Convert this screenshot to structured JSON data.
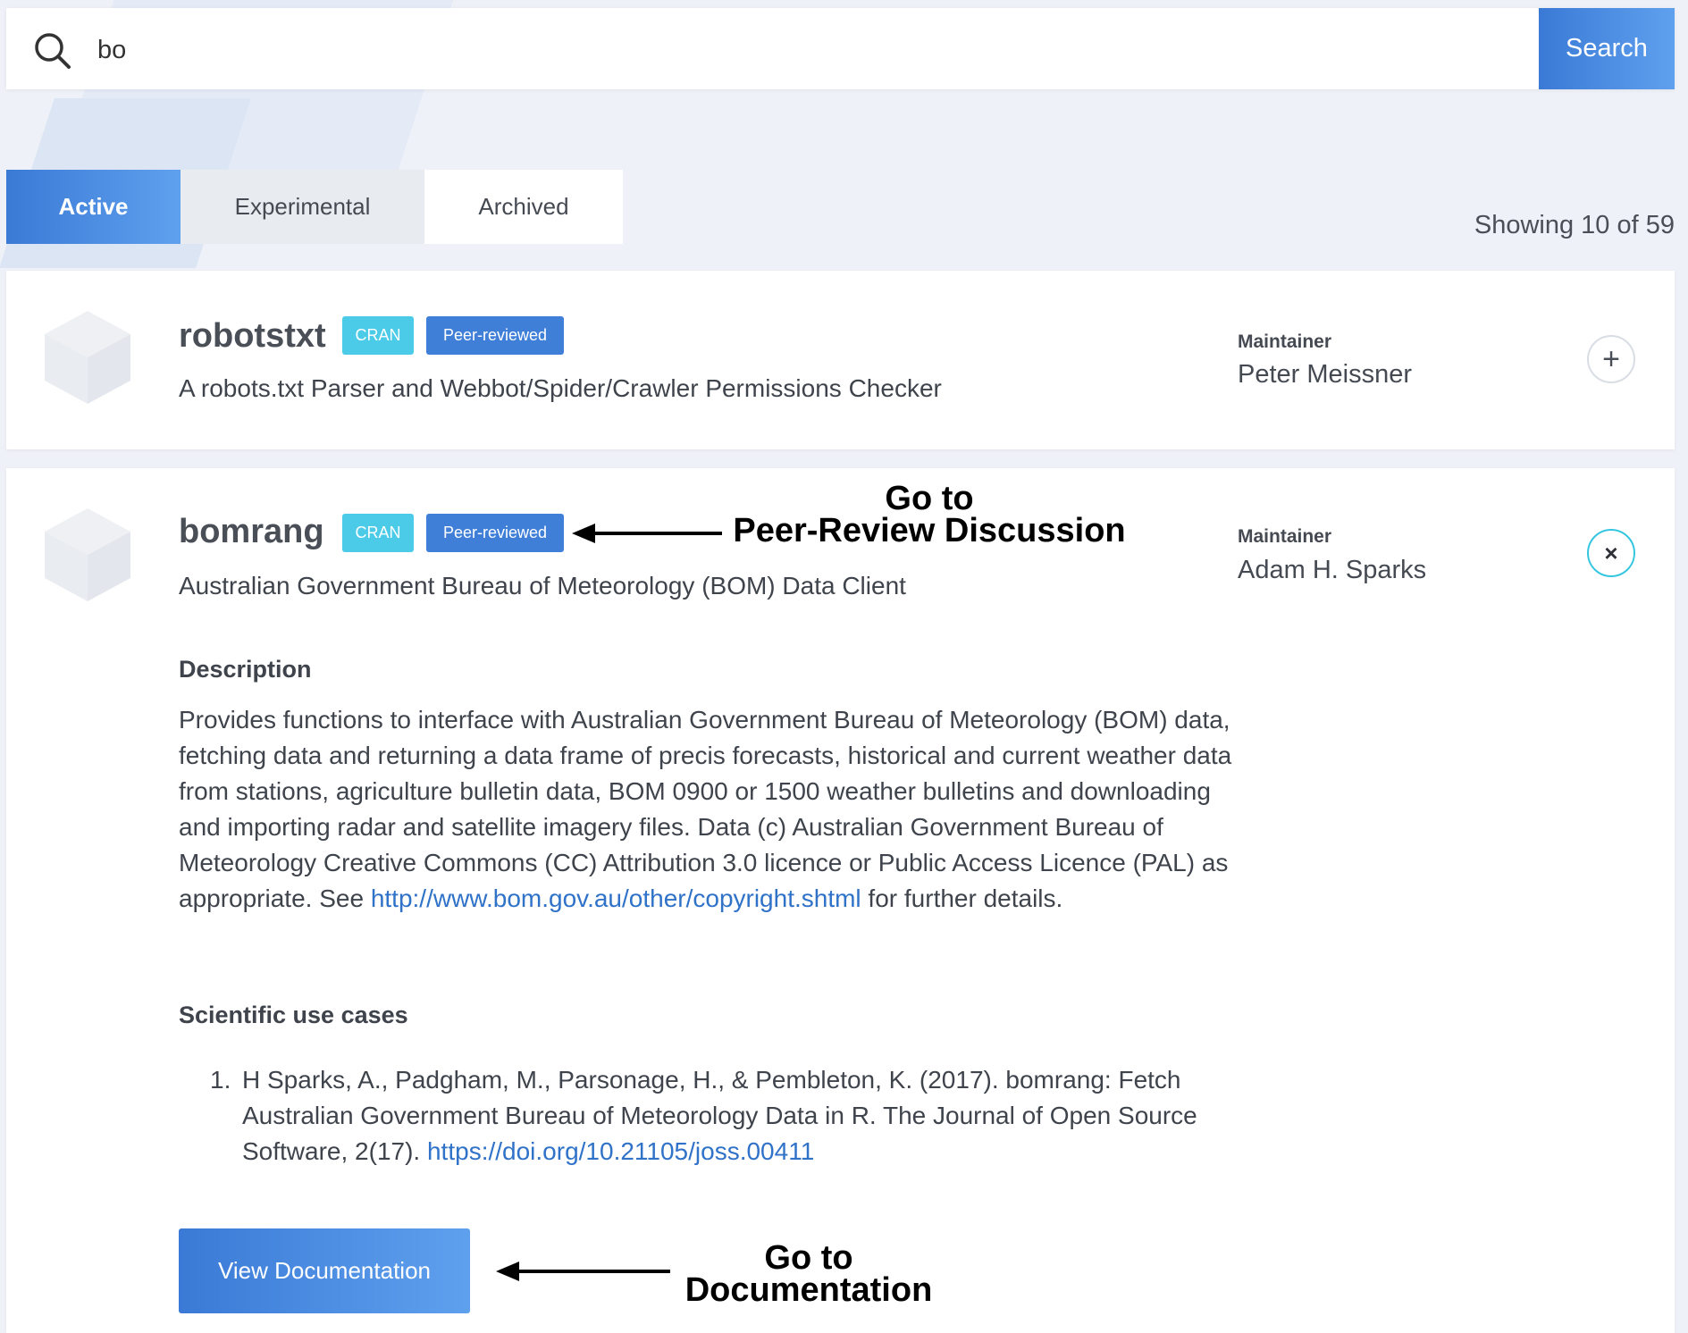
{
  "search": {
    "value": "bo",
    "button_label": "Search"
  },
  "tabs": [
    {
      "label": "Active",
      "active": true
    },
    {
      "label": "Experimental",
      "active": false
    },
    {
      "label": "Archived",
      "active": false
    }
  ],
  "results_count": "Showing 10 of 59",
  "packages": [
    {
      "name": "robotstxt",
      "badges": [
        "CRAN",
        "Peer-reviewed"
      ],
      "title": "A robots.txt Parser and Webbot/Spider/Crawler Permissions Checker",
      "maintainer_label": "Maintainer",
      "maintainer": "Peter Meissner",
      "toggle": "+"
    },
    {
      "name": "bomrang",
      "badges": [
        "CRAN",
        "Peer-reviewed"
      ],
      "title": "Australian Government Bureau of Meteorology (BOM) Data Client",
      "maintainer_label": "Maintainer",
      "maintainer": "Adam H. Sparks",
      "toggle": "×",
      "description_heading": "Description",
      "description_text": "Provides functions to interface with Australian Government Bureau of Meteorology (BOM) data, fetching data and returning a data frame of precis forecasts, historical and current weather data from stations, agriculture bulletin data, BOM 0900 or 1500 weather bulletins and downloading and importing radar and satellite imagery files. Data (c) Australian Government Bureau of Meteorology Creative Commons (CC) Attribution 3.0 licence or Public Access Licence (PAL) as appropriate. See ",
      "description_link": "http://www.bom.gov.au/other/copyright.shtml",
      "description_suffix": " for further details.",
      "use_cases_heading": "Scientific use cases",
      "use_cases": [
        {
          "number": "1.",
          "text": "H Sparks, A., Padgham, M., Parsonage, H., & Pembleton, K. (2017). bomrang: Fetch Australian Government Bureau of Meteorology Data in R. The Journal of Open Source Software, 2(17). ",
          "link": "https://doi.org/10.21105/joss.00411"
        }
      ],
      "doc_button_label": "View Documentation"
    }
  ],
  "annotations": {
    "peer_review_line1": "Go to",
    "peer_review_line2": "Peer-Review Discussion",
    "docs_line1": "Go to",
    "docs_line2": "Documentation"
  },
  "colors": {
    "accent": "#3f7fd8",
    "cran": "#4ccbe8",
    "link": "#2f72c8"
  }
}
